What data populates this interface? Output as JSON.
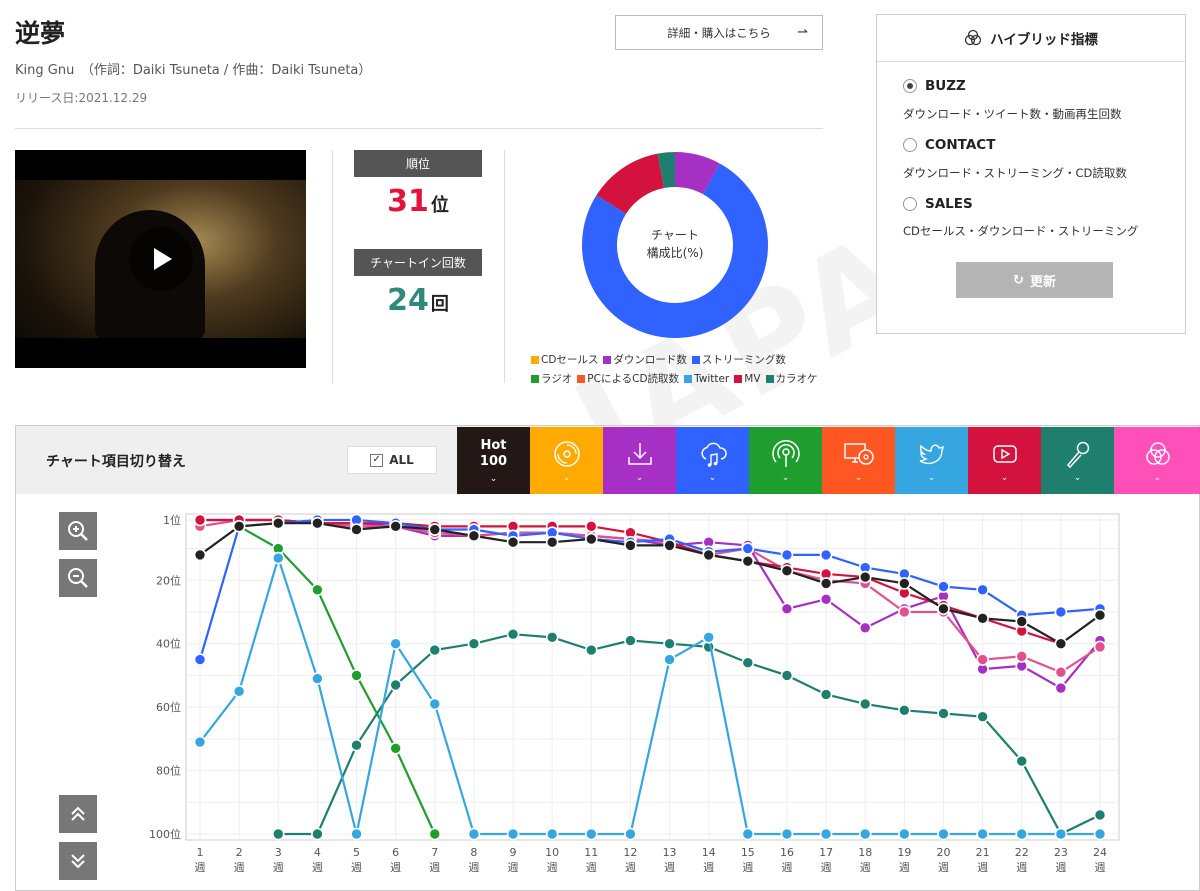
{
  "song": {
    "title": "逆夢",
    "meta": "King Gnu　（作詞：Daiki Tsuneta / 作曲：Daiki Tsuneta）",
    "release": "リリース日:2021.12.29",
    "buy_label": "詳細・購入はこちら"
  },
  "stats": {
    "rank_label": "順位",
    "rank_value": "31",
    "rank_unit": "位",
    "chartin_label": "チャートイン回数",
    "chartin_value": "24",
    "chartin_unit": "回",
    "rank_color": "#e3143c",
    "chartin_color": "#2e8b7a"
  },
  "donut": {
    "center_line1": "チャート",
    "center_line2": "構成比(%)",
    "segments": [
      {
        "name": "ダウンロード数",
        "value": 8,
        "color": "#a62fc4"
      },
      {
        "name": "ストリーミング数",
        "value": 76,
        "color": "#2f62ff"
      },
      {
        "name": "MV",
        "value": 13,
        "color": "#d3133e"
      },
      {
        "name": "カラオケ",
        "value": 3,
        "color": "#1f7f6e"
      }
    ]
  },
  "legend": {
    "row1": [
      {
        "name": "CDセールス",
        "color": "#ffaa00"
      },
      {
        "name": "ダウンロード数",
        "color": "#a62fc4"
      },
      {
        "name": "ストリーミング数",
        "color": "#2f62ff"
      }
    ],
    "row2": [
      {
        "name": "ラジオ",
        "color": "#1f9e2f"
      },
      {
        "name": "PCによるCD読取数",
        "color": "#ff5722"
      },
      {
        "name": "Twitter",
        "color": "#35a6e0"
      },
      {
        "name": "MV",
        "color": "#d3133e"
      },
      {
        "name": "カラオケ",
        "color": "#1f7f6e"
      }
    ]
  },
  "hybrid": {
    "title": "ハイブリッド指標",
    "options": [
      {
        "label": "BUZZ",
        "desc": "ダウンロード・ツイート数・動画再生回数",
        "selected": true
      },
      {
        "label": "CONTACT",
        "desc": "ダウンロード・ストリーミング・CD読取数",
        "selected": false
      },
      {
        "label": "SALES",
        "desc": "CDセールス・ダウンロード・ストリーミング",
        "selected": false
      }
    ],
    "update_label": "更新"
  },
  "chart_panel": {
    "switch_label": "チャート項目切り替え",
    "all_label": "ALL",
    "hot_label_1": "Hot",
    "hot_label_2": "100",
    "tabs": [
      {
        "name": "hot100",
        "color": "#231815",
        "icon": "hot100-text"
      },
      {
        "name": "cd-sales",
        "color": "#ffaa00",
        "icon": "cd-icon"
      },
      {
        "name": "download",
        "color": "#a62fc4",
        "icon": "download-icon"
      },
      {
        "name": "streaming",
        "color": "#2f62ff",
        "icon": "cloud-music-icon"
      },
      {
        "name": "radio",
        "color": "#1f9e2f",
        "icon": "radio-icon"
      },
      {
        "name": "pc-cd-read",
        "color": "#ff5722",
        "icon": "pc-cd-icon"
      },
      {
        "name": "twitter",
        "color": "#35a6e0",
        "icon": "twitter-icon"
      },
      {
        "name": "mv",
        "color": "#d3133e",
        "icon": "youtube-icon"
      },
      {
        "name": "karaoke",
        "color": "#1f7f6e",
        "icon": "microphone-icon"
      },
      {
        "name": "hybrid",
        "color": "#ff4fb9",
        "icon": "hybrid-icon"
      }
    ]
  },
  "chart_data": {
    "type": "line",
    "y_reversed": true,
    "ylim": [
      1,
      100
    ],
    "y_ticks": [
      1,
      20,
      40,
      60,
      80,
      100
    ],
    "y_tick_labels": [
      "1位",
      "20位",
      "40位",
      "60位",
      "80位",
      "100位"
    ],
    "x": [
      "1",
      "2",
      "3",
      "4",
      "5",
      "6",
      "7",
      "8",
      "9",
      "10",
      "11",
      "12",
      "13",
      "14",
      "15",
      "16",
      "17",
      "18",
      "19",
      "20",
      "21",
      "22",
      "23",
      "24"
    ],
    "x_unit": "週",
    "grid": true,
    "series": [
      {
        "name": "カラオケ",
        "color": "#1f7f6e",
        "values": [
          null,
          null,
          100,
          100,
          72,
          53,
          42,
          40,
          37,
          38,
          42,
          39,
          40,
          41,
          46,
          50,
          56,
          59,
          61,
          62,
          63,
          77,
          100,
          94
        ]
      },
      {
        "name": "ラジオ",
        "color": "#1f9e2f",
        "values": [
          null,
          3,
          10,
          23,
          50,
          73,
          100,
          null,
          null,
          null,
          null,
          null,
          null,
          null,
          null,
          null,
          null,
          null,
          null,
          null,
          null,
          null,
          null,
          null
        ]
      },
      {
        "name": "Twitter",
        "color": "#35a6e0",
        "values": [
          71,
          55,
          13,
          51,
          100,
          40,
          59,
          100,
          100,
          100,
          100,
          100,
          45,
          38,
          100,
          100,
          100,
          100,
          100,
          100,
          100,
          100,
          100,
          100
        ]
      },
      {
        "name": "ダウンロード数",
        "color": "#a62fc4",
        "values": [
          1,
          1,
          1,
          2,
          2,
          3,
          6,
          6,
          5,
          5,
          6,
          7,
          9,
          8,
          9,
          29,
          26,
          35,
          29,
          25,
          48,
          47,
          54,
          39
        ]
      },
      {
        "name": "",
        "color": "#e2508f",
        "values": [
          3,
          1,
          1,
          2,
          3,
          3,
          5,
          6,
          5,
          5,
          6,
          7,
          8,
          12,
          10,
          17,
          20,
          21,
          30,
          30,
          45,
          44,
          49,
          41
        ]
      },
      {
        "name": "MV",
        "color": "#d3133e",
        "values": [
          1,
          1,
          1,
          2,
          2,
          2,
          3,
          3,
          3,
          3,
          3,
          5,
          8,
          12,
          14,
          16,
          18,
          19,
          24,
          28,
          32,
          36,
          40,
          null
        ]
      },
      {
        "name": "ストリーミング数",
        "color": "#2f62ff",
        "values": [
          45,
          3,
          2,
          1,
          1,
          2,
          4,
          4,
          6,
          5,
          7,
          8,
          7,
          11,
          10,
          12,
          12,
          16,
          18,
          22,
          23,
          31,
          30,
          29
        ]
      },
      {
        "name": "Hot 100",
        "color": "#222222",
        "values": [
          12,
          3,
          2,
          2,
          4,
          3,
          4,
          6,
          8,
          8,
          7,
          9,
          9,
          12,
          14,
          17,
          21,
          19,
          21,
          29,
          32,
          33,
          40,
          31
        ]
      }
    ]
  }
}
